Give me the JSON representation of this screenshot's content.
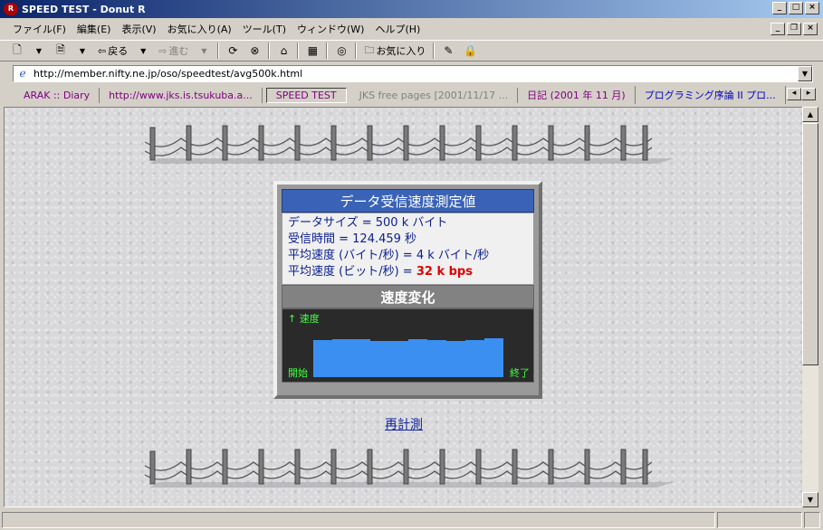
{
  "window": {
    "title": "SPEED TEST - Donut R",
    "app_icon": "R"
  },
  "menu": {
    "items": [
      "ファイル(F)",
      "編集(E)",
      "表示(V)",
      "お気に入り(A)",
      "ツール(T)",
      "ウィンドウ(W)",
      "ヘルプ(H)"
    ]
  },
  "toolbar": {
    "back_label": "戻る",
    "forward_label": "進む",
    "favorites_label": "お気に入り"
  },
  "address": {
    "url": "http://member.nifty.ne.jp/oso/speedtest/avg500k.html"
  },
  "tabs": [
    {
      "label": "ARAK :: Diary",
      "state": "normal"
    },
    {
      "label": "http://www.jks.is.tsukuba.a...",
      "state": "normal"
    },
    {
      "label": "SPEED TEST",
      "state": "active"
    },
    {
      "label": "JKS free pages [2001/11/17 ...",
      "state": "gray"
    },
    {
      "label": "日記 (2001 年 11 月)",
      "state": "normal"
    },
    {
      "label": "プログラミング序論 II プロ...",
      "state": "loaded"
    }
  ],
  "page": {
    "panel_title": "データ受信速度測定値",
    "data_size": "データサイズ = 500 k バイト",
    "recv_time": "受信時間 = 124.459 秒",
    "avg_bytes": "平均速度 (バイト/秒) = 4 k バイト/秒",
    "avg_bits_prefix": "平均速度 (ビット/秒) = ",
    "avg_bits_value": "32 k bps",
    "graph_title": "速度変化",
    "graph_speed_label": "↑ 速度",
    "graph_start_label": "開始",
    "graph_end_label": "終了",
    "remeasure_link": "再計測"
  },
  "chart_data": {
    "type": "bar",
    "values": [
      57,
      58,
      58,
      55,
      55,
      59,
      57,
      56,
      57,
      60
    ]
  }
}
